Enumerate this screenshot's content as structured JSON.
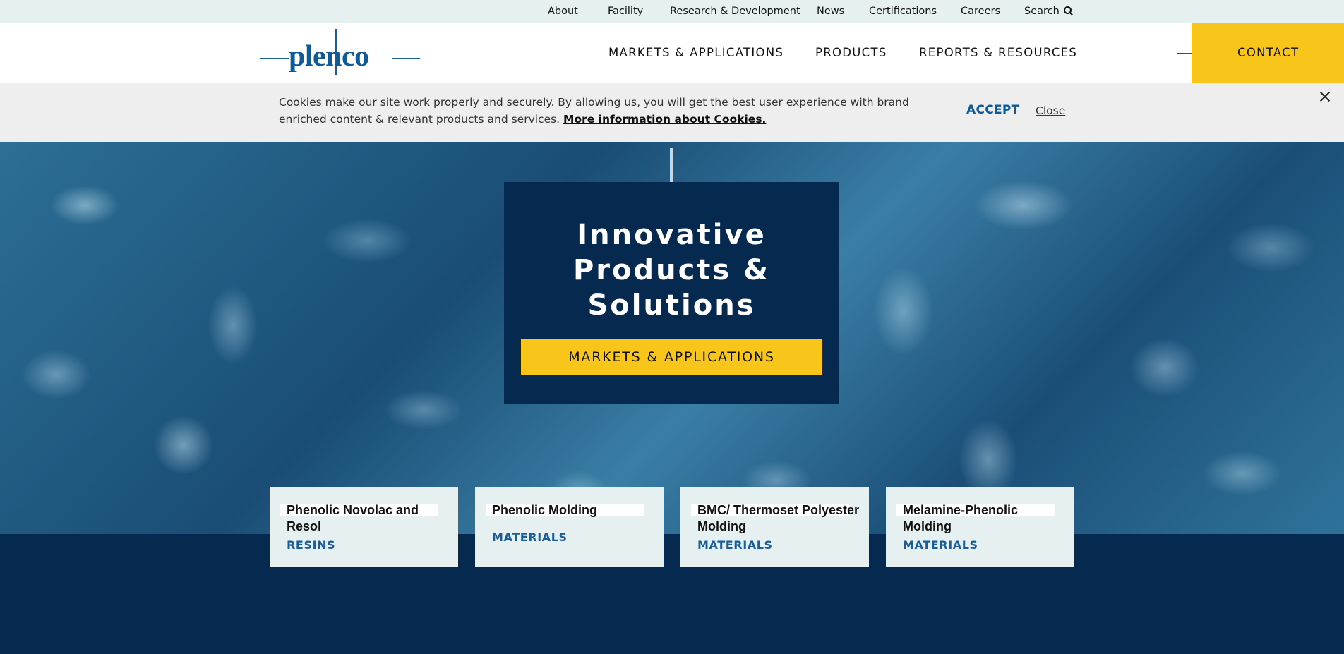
{
  "utility_nav": {
    "items": [
      "About",
      "Facility",
      "Research & Development",
      "News",
      "Certifications",
      "Careers"
    ],
    "search_label": "Search"
  },
  "header": {
    "logo_text": "plenco",
    "nav": [
      "MARKETS & APPLICATIONS",
      "PRODUCTS",
      "REPORTS & RESOURCES"
    ],
    "contact_label": "CONTACT"
  },
  "cookie_banner": {
    "message": "Cookies make our site work properly and securely. By allowing us, you will get the best user experience with brand enriched content & relevant products and services. ",
    "more_link": "More information about Cookies.",
    "accept_label": "ACCEPT",
    "close_label": "Close"
  },
  "hero": {
    "title": "Innovative Products & Solutions",
    "cta_label": "MARKETS & APPLICATIONS"
  },
  "products": [
    {
      "name": "Phenolic Novolac and Resol",
      "category": "RESINS"
    },
    {
      "name": "Phenolic Molding",
      "category": "MATERIALS"
    },
    {
      "name": "BMC/ Thermoset Polyester Molding",
      "category": "MATERIALS"
    },
    {
      "name": "Melamine-Phenolic Molding",
      "category": "MATERIALS"
    }
  ],
  "colors": {
    "navy": "#05294f",
    "accent_yellow": "#f8c61a",
    "brand_blue": "#0f5a98",
    "utility_bar_bg": "#e6f0f1",
    "cookie_bg": "#eeeeee"
  },
  "icons": {
    "search": "search-icon",
    "close": "close-icon"
  }
}
